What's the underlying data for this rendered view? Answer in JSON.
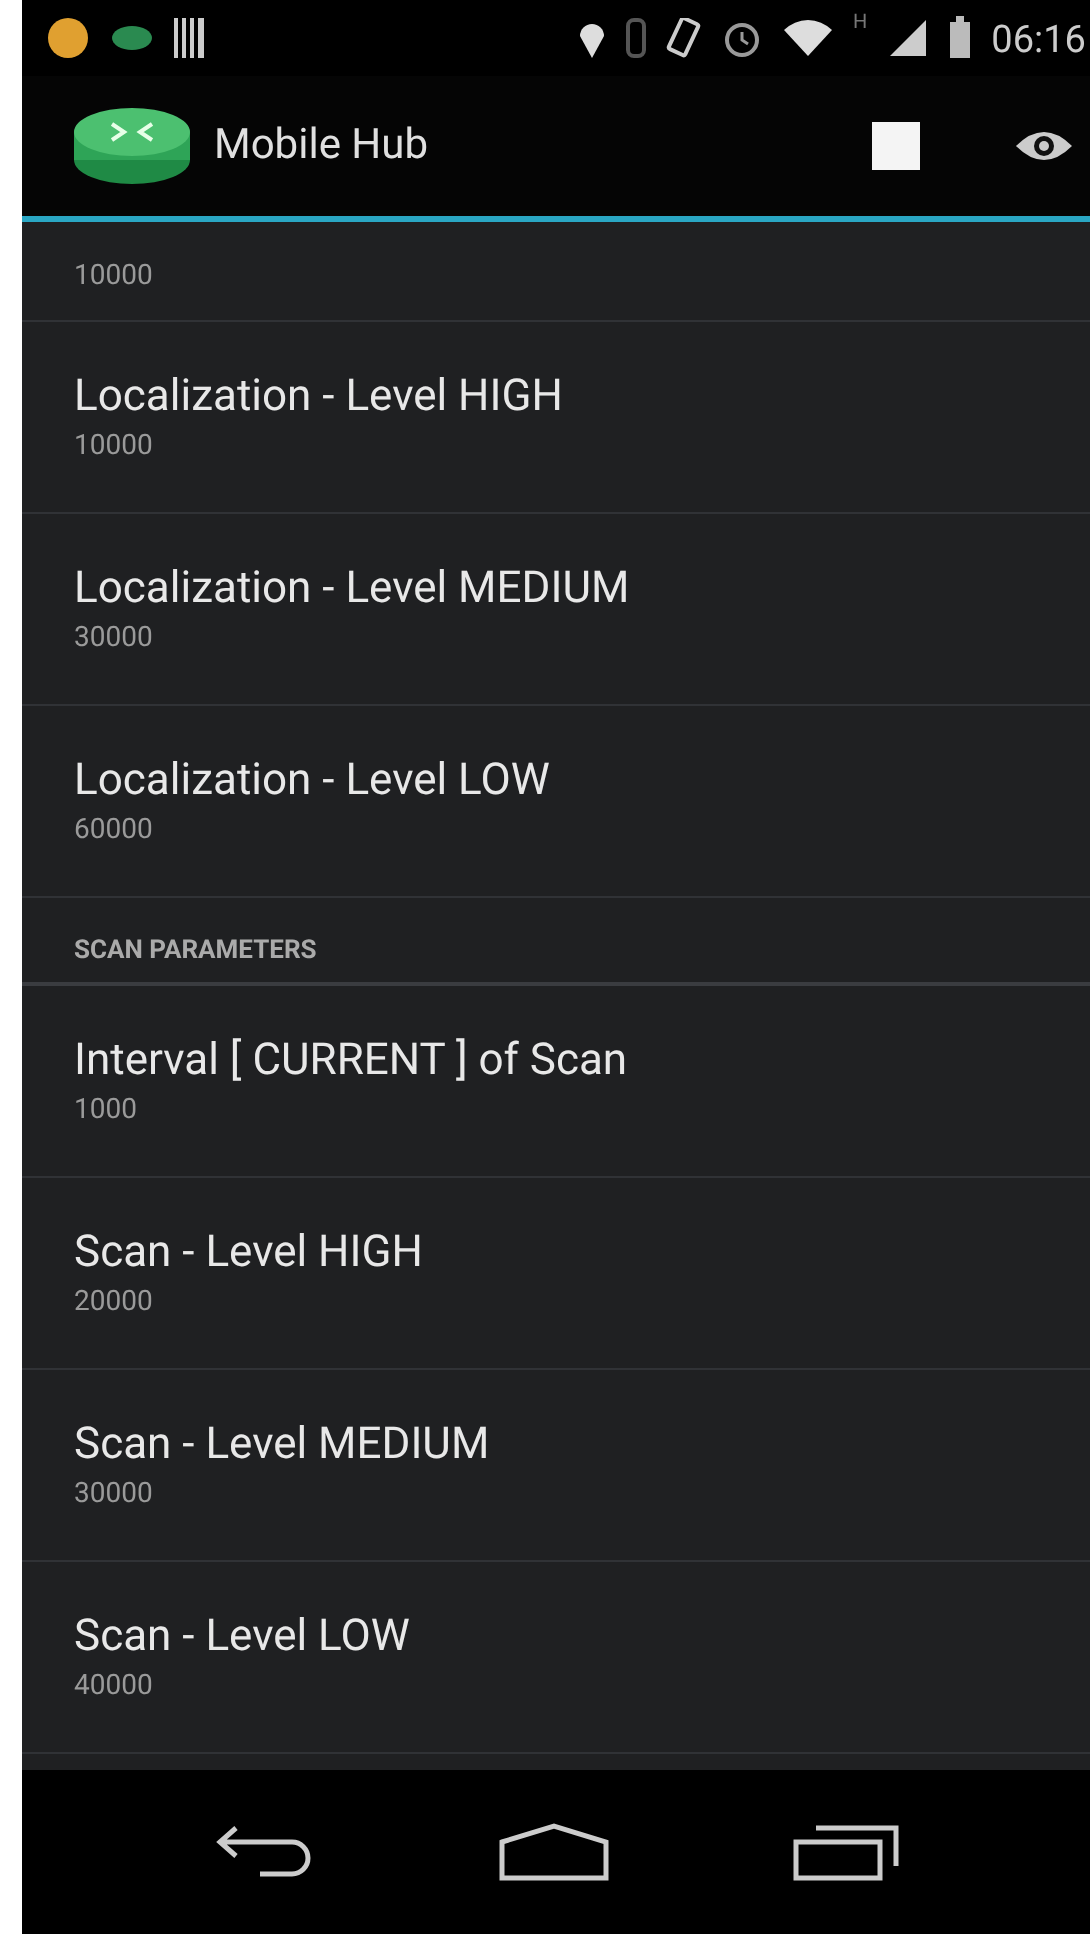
{
  "status_bar": {
    "time": "06:16",
    "network_type": "H"
  },
  "action_bar": {
    "title": "Mobile Hub"
  },
  "preferences": [
    {
      "kind": "item",
      "summary": "10000"
    },
    {
      "kind": "item",
      "title": "Localization - Level HIGH",
      "summary": "10000"
    },
    {
      "kind": "item",
      "title": "Localization - Level MEDIUM",
      "summary": "30000"
    },
    {
      "kind": "item",
      "title": "Localization - Level LOW",
      "summary": "60000"
    },
    {
      "kind": "header",
      "title": "SCAN PARAMETERS"
    },
    {
      "kind": "item",
      "title": "Interval [ CURRENT ] of Scan",
      "summary": "1000"
    },
    {
      "kind": "item",
      "title": "Scan - Level HIGH",
      "summary": "20000"
    },
    {
      "kind": "item",
      "title": "Scan - Level MEDIUM",
      "summary": "30000"
    },
    {
      "kind": "item",
      "title": "Scan - Level LOW",
      "summary": "40000"
    }
  ]
}
